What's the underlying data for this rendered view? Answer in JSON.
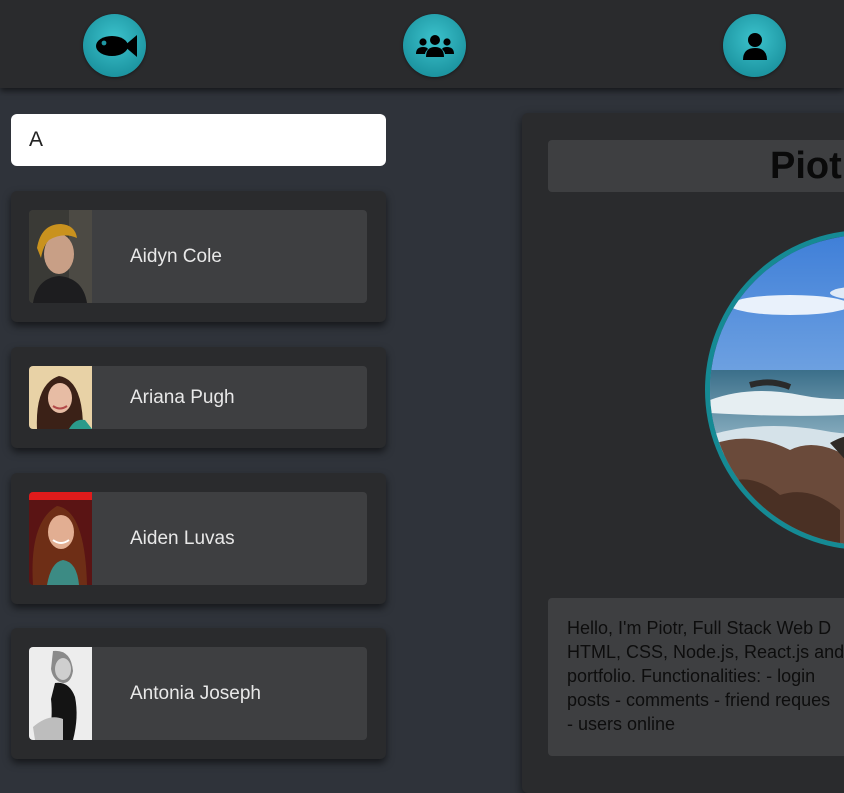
{
  "nav": {
    "home_icon": "fish-icon",
    "friends_icon": "users-group-icon",
    "profile_icon": "user-icon",
    "accent_color": "#1e97a3"
  },
  "search": {
    "value": "A"
  },
  "users": [
    {
      "name": "Aidyn Cole"
    },
    {
      "name": "Ariana Pugh"
    },
    {
      "name": "Aiden Luvas"
    },
    {
      "name": "Antonia Joseph"
    }
  ],
  "profile": {
    "name": "Piotr",
    "bio": "Hello, I'm Piotr, Full Stack Web D\nHTML, CSS, Node.js, React.js and\nportfolio. Functionalities: - login\nposts - comments - friend reques\n- users online"
  }
}
